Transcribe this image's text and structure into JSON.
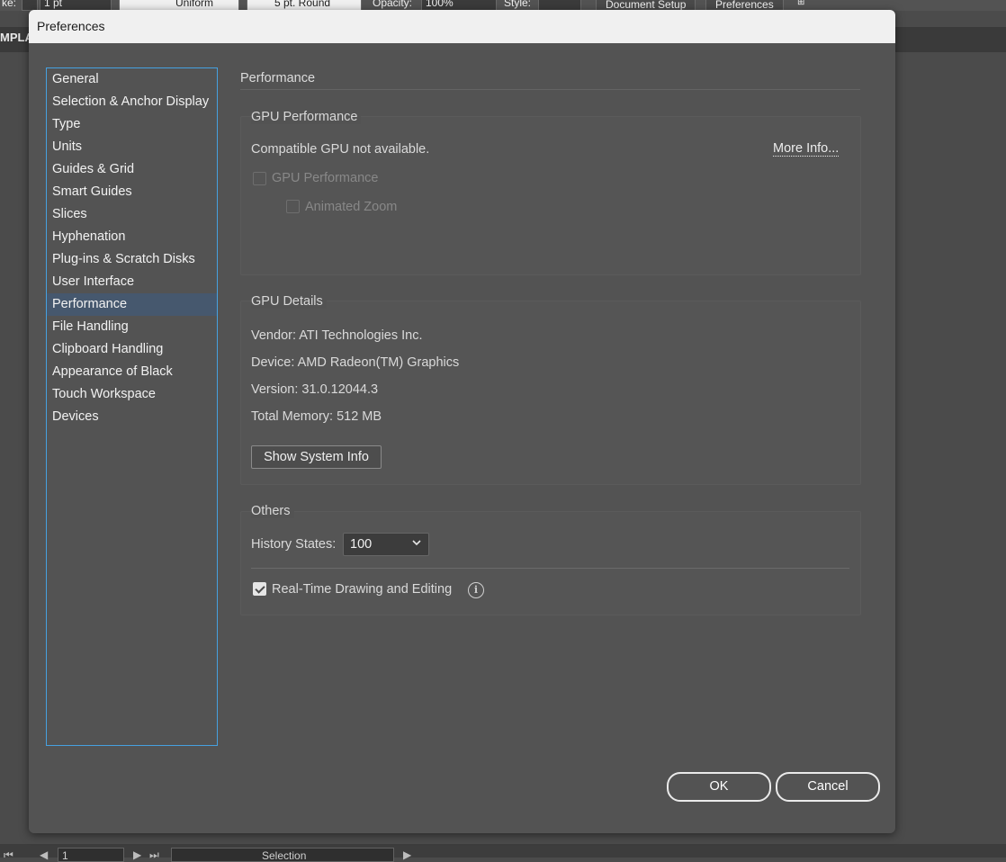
{
  "app_bar": {
    "stroke_label": "ke:",
    "stroke_weight": "1 pt",
    "profile": "Uniform",
    "brush": "5 pt. Round",
    "opacity_label": "Opacity:",
    "opacity_value": "100%",
    "style_label": "Style:",
    "document_setup": "Document Setup",
    "preferences": "Preferences"
  },
  "doc_tab": "MPLA",
  "status_bar": {
    "page": "1",
    "mode": "Selection"
  },
  "dialog": {
    "title": "Preferences",
    "nav": {
      "items": [
        "General",
        "Selection & Anchor Display",
        "Type",
        "Units",
        "Guides & Grid",
        "Smart Guides",
        "Slices",
        "Hyphenation",
        "Plug-ins & Scratch Disks",
        "User Interface",
        "Performance",
        "File Handling",
        "Clipboard Handling",
        "Appearance of Black",
        "Touch Workspace",
        "Devices"
      ],
      "active": "Performance"
    },
    "panel_title": "Performance",
    "gpu_performance": {
      "label": "GPU Performance",
      "status": "Compatible GPU not available.",
      "more_info": "More Info...",
      "gpu_checkbox": "GPU Performance",
      "zoom_checkbox": "Animated Zoom"
    },
    "gpu_details": {
      "label": "GPU Details",
      "vendor": "Vendor: ATI Technologies Inc.",
      "device": "Device: AMD Radeon(TM) Graphics",
      "version": "Version: 31.0.12044.3",
      "memory": "Total Memory: 512 MB",
      "show_system_info": "Show System Info"
    },
    "others": {
      "label": "Others",
      "history_label": "History States:",
      "history_value": "100",
      "realtime_label": "Real-Time Drawing and Editing",
      "realtime_checked": true
    },
    "ok": "OK",
    "cancel": "Cancel"
  }
}
